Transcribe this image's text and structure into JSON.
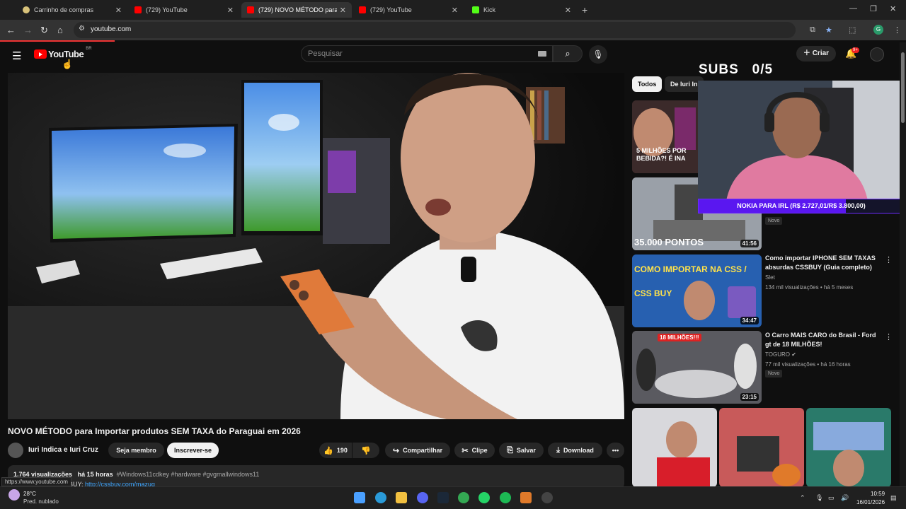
{
  "browser": {
    "tabs": [
      {
        "title": "Carrinho de compras",
        "color": "#d8c27a",
        "active": false
      },
      {
        "title": "(729) YouTube",
        "color": "#ff0000",
        "active": false
      },
      {
        "title": "(729) NOVO MÉTODO para Imp",
        "color": "#ff0000",
        "active": true
      },
      {
        "title": "(729) YouTube",
        "color": "#ff0000",
        "active": false
      },
      {
        "title": "Kick",
        "color": "#53fc18",
        "active": false
      }
    ],
    "url": "youtube.com",
    "profile_initial": "G"
  },
  "youtube": {
    "logo_text": "YouTube",
    "country": "BR",
    "search_placeholder": "Pesquisar",
    "create_label": "Criar",
    "notif_badge": "9+"
  },
  "video": {
    "title": "NOVO MÉTODO para Importar produtos SEM TAXA do Paraguai em 2026",
    "channel": "Iuri Indica e Iuri Cruz",
    "join_label": "Seja membro",
    "subscribe_label": "Inscrever-se",
    "likes": "190",
    "share_label": "Compartilhar",
    "clip_label": "Clipe",
    "save_label": "Salvar",
    "download_label": "Download",
    "more_label": "•••",
    "views": "1.764 visualizações",
    "age": "há 15 horas",
    "tags": "#Windows11cdkey #hardware #gvgmallwindows11",
    "desc_prefix": "o CSSBUY:",
    "desc_link": "http://cssbuy.com/mazuq",
    "status_url": "https://www.youtube.com"
  },
  "sidebar": {
    "chips": [
      "Todos",
      "De Iuri In"
    ],
    "items": [
      {
        "thumb_text": "5 MILHÕES POR BEBIDA?! É INA",
        "duration": "",
        "title": "",
        "channel": "",
        "meta": "",
        "novo": ""
      },
      {
        "thumb_text": "35.000 PONTOS",
        "duration": "41:56",
        "title": "",
        "channel": "",
        "meta": "",
        "novo": "Novo"
      },
      {
        "thumb_text": "COMO IMPORTAR NA CSS / CSS BUY",
        "duration": "34:47",
        "title": "Como importar IPHONE SEM TAXAS absurdas CSSBUY (Guia completo)",
        "channel": "Slet",
        "meta": "134 mil visualizações • há 5 meses",
        "novo": ""
      },
      {
        "thumb_text": "18 MILHÕES!!!",
        "duration": "23:15",
        "title": "O Carro MAIS CARO do Brasil - Ford gt de 18 MILHÕES!",
        "channel": "TOGURO",
        "meta": "77 mil visualizações • há 16 horas",
        "novo": "Novo"
      }
    ]
  },
  "overlay": {
    "subs_label": "SUBS",
    "subs_count": "0/5",
    "goal_text": "NOKIA PARA IRL (R$ 2.727,01/R$ 3.800,00)",
    "goal_fraction": 0.7176
  },
  "taskbar": {
    "temp": "28°C",
    "weather": "Pred. nublado",
    "time": "10:59",
    "date": "16/01/2026"
  }
}
